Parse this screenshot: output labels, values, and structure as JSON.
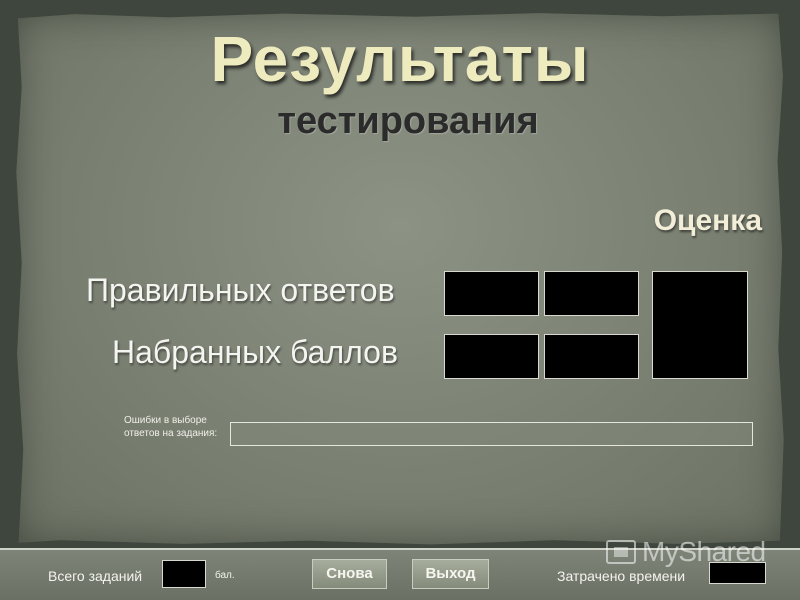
{
  "header": {
    "title": "Результаты",
    "subtitle": "тестирования"
  },
  "results": {
    "grade_label": "Оценка",
    "correct_label": "Правильных ответов",
    "points_label": "Набранных баллов",
    "errors_label": "Ошибки в выборе ответов на задания:"
  },
  "footer": {
    "total_label": "Всего заданий",
    "unit_label": "бал.",
    "again_label": "Снова",
    "exit_label": "Выход",
    "time_label": "Затрачено времени"
  },
  "watermark": {
    "text": "MyShared"
  },
  "colors": {
    "title": "#eeecbf",
    "subtitle": "#2b2b2b",
    "board": "#7a8072",
    "box": "#000000"
  }
}
